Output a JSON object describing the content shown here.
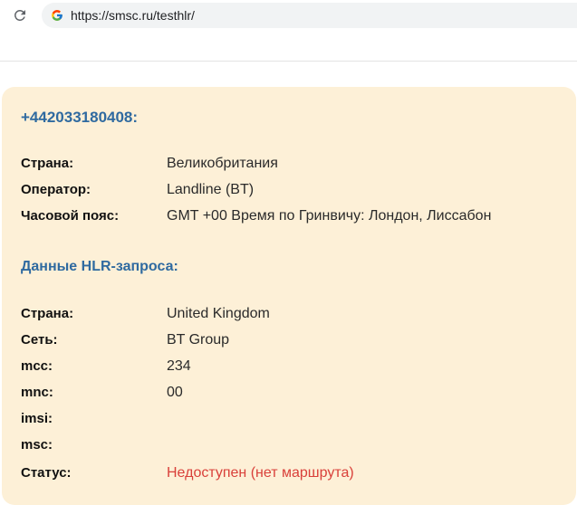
{
  "browser": {
    "url": "https://smsc.ru/testhlr/"
  },
  "result": {
    "phone": "+442033180408:",
    "info_rows": [
      {
        "label": "Страна:",
        "value": "Великобритания"
      },
      {
        "label": "Оператор:",
        "value": "Landline (BT)"
      },
      {
        "label": "Часовой пояс:",
        "value": "GMT +00 Время по Гринвичу: Лондон, Лиссабон"
      }
    ],
    "hlr_title": "Данные HLR-запроса:",
    "hlr_rows": [
      {
        "label": "Страна:",
        "value": "United Kingdom"
      },
      {
        "label": "Сеть:",
        "value": "BT Group"
      },
      {
        "label": "mcc:",
        "value": "234"
      },
      {
        "label": "mnc:",
        "value": "00"
      },
      {
        "label": "imsi:",
        "value": ""
      },
      {
        "label": "msc:",
        "value": ""
      }
    ],
    "status": {
      "label": "Статус:",
      "value": "Недоступен (нет маршрута)"
    }
  },
  "colors": {
    "card_background": "#fdf0d7",
    "heading_blue": "#2f6aa0",
    "status_red": "#d9403a"
  },
  "icons": {
    "reload": "reload-icon",
    "site": "google-g-icon"
  }
}
